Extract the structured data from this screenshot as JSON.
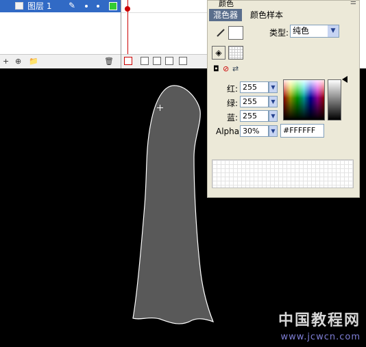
{
  "timeline": {
    "layer_name": "图层 1",
    "layer_pencil": "✎",
    "layer_tools": {
      "add_layer": "+",
      "add_guide": "⊕",
      "add_folder": "📁",
      "delete": "🗑"
    }
  },
  "color_panel": {
    "title": "颜色",
    "menu_icon": "☰",
    "tabs": [
      "混色器",
      "颜色样本"
    ],
    "type_label": "类型:",
    "type_value": "纯色",
    "rgb": [
      {
        "label": "红:",
        "value": "255"
      },
      {
        "label": "绿:",
        "value": "255"
      },
      {
        "label": "蓝:",
        "value": "255"
      }
    ],
    "alpha_label": "Alpha:",
    "alpha_value": "30%",
    "hex_value": "#FFFFFF",
    "colors": {
      "shape_fill": "#595959",
      "shape_stroke": "#ffffff",
      "active_tab": "#5a6e8c",
      "selected_layer": "#316ac5"
    }
  },
  "watermark": {
    "text": "中国教程网",
    "url": "www.jcwcn.com"
  }
}
